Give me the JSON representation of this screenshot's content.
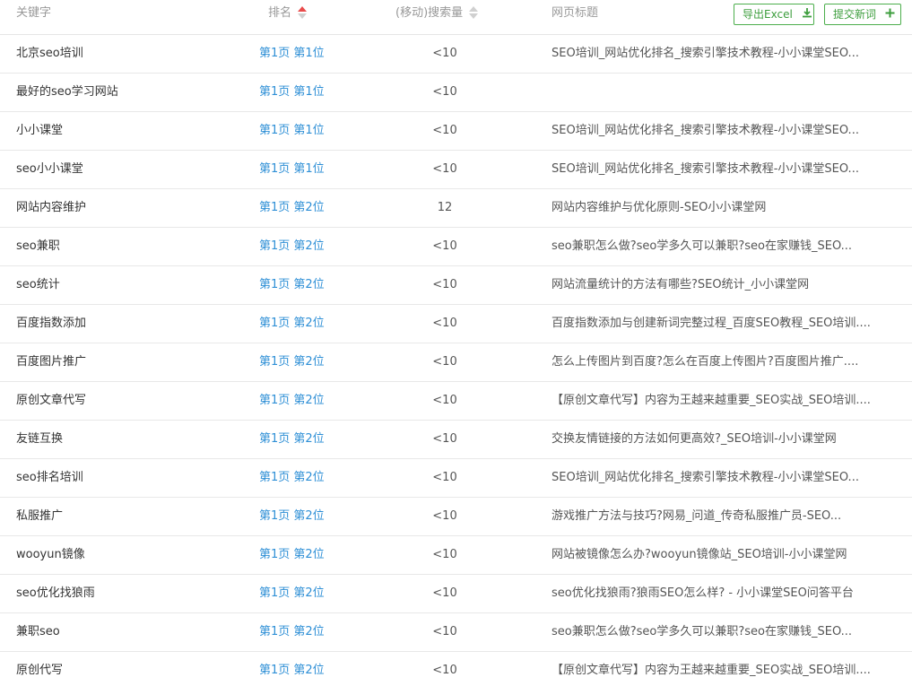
{
  "header": {
    "keyword": "关键字",
    "rank": "排名",
    "volume": "(移动)搜索量",
    "title": "网页标题",
    "export_label": "导出Excel",
    "submit_label": "提交新词"
  },
  "colors": {
    "accent_green": "#3c9d3c",
    "link_blue": "#2e8fd6",
    "sort_active": "#e94b4b"
  },
  "rows": [
    {
      "keyword": "北京seo培训",
      "rank": "第1页 第1位",
      "volume": "<10",
      "title": "SEO培训_网站优化排名_搜索引擎技术教程-小小课堂SEO..."
    },
    {
      "keyword": "最好的seo学习网站",
      "rank": "第1页 第1位",
      "volume": "<10",
      "title": ""
    },
    {
      "keyword": "小小课堂",
      "rank": "第1页 第1位",
      "volume": "<10",
      "title": "SEO培训_网站优化排名_搜索引擎技术教程-小小课堂SEO..."
    },
    {
      "keyword": "seo小小课堂",
      "rank": "第1页 第1位",
      "volume": "<10",
      "title": "SEO培训_网站优化排名_搜索引擎技术教程-小小课堂SEO..."
    },
    {
      "keyword": "网站内容维护",
      "rank": "第1页 第2位",
      "volume": "12",
      "title": "网站内容维护与优化原则-SEO小小课堂网"
    },
    {
      "keyword": "seo兼职",
      "rank": "第1页 第2位",
      "volume": "<10",
      "title": "seo兼职怎么做?seo学多久可以兼职?seo在家赚钱_SEO..."
    },
    {
      "keyword": "seo统计",
      "rank": "第1页 第2位",
      "volume": "<10",
      "title": "网站流量统计的方法有哪些?SEO统计_小小课堂网"
    },
    {
      "keyword": "百度指数添加",
      "rank": "第1页 第2位",
      "volume": "<10",
      "title": "百度指数添加与创建新词完整过程_百度SEO教程_SEO培训...."
    },
    {
      "keyword": "百度图片推广",
      "rank": "第1页 第2位",
      "volume": "<10",
      "title": "怎么上传图片到百度?怎么在百度上传图片?百度图片推广...."
    },
    {
      "keyword": "原创文章代写",
      "rank": "第1页 第2位",
      "volume": "<10",
      "title": "【原创文章代写】内容为王越来越重要_SEO实战_SEO培训...."
    },
    {
      "keyword": "友链互换",
      "rank": "第1页 第2位",
      "volume": "<10",
      "title": "交换友情链接的方法如何更高效?_SEO培训-小小课堂网"
    },
    {
      "keyword": "seo排名培训",
      "rank": "第1页 第2位",
      "volume": "<10",
      "title": "SEO培训_网站优化排名_搜索引擎技术教程-小小课堂SEO..."
    },
    {
      "keyword": "私服推广",
      "rank": "第1页 第2位",
      "volume": "<10",
      "title": "游戏推广方法与技巧?网易_问道_传奇私服推广员-SEO..."
    },
    {
      "keyword": "wooyun镜像",
      "rank": "第1页 第2位",
      "volume": "<10",
      "title": "网站被镜像怎么办?wooyun镜像站_SEO培训-小小课堂网"
    },
    {
      "keyword": "seo优化找狼雨",
      "rank": "第1页 第2位",
      "volume": "<10",
      "title": "seo优化找狼雨?狼雨SEO怎么样? - 小小课堂SEO问答平台"
    },
    {
      "keyword": "兼职seo",
      "rank": "第1页 第2位",
      "volume": "<10",
      "title": "seo兼职怎么做?seo学多久可以兼职?seo在家赚钱_SEO..."
    },
    {
      "keyword": "原创代写",
      "rank": "第1页 第2位",
      "volume": "<10",
      "title": "【原创文章代写】内容为王越来越重要_SEO实战_SEO培训...."
    }
  ]
}
